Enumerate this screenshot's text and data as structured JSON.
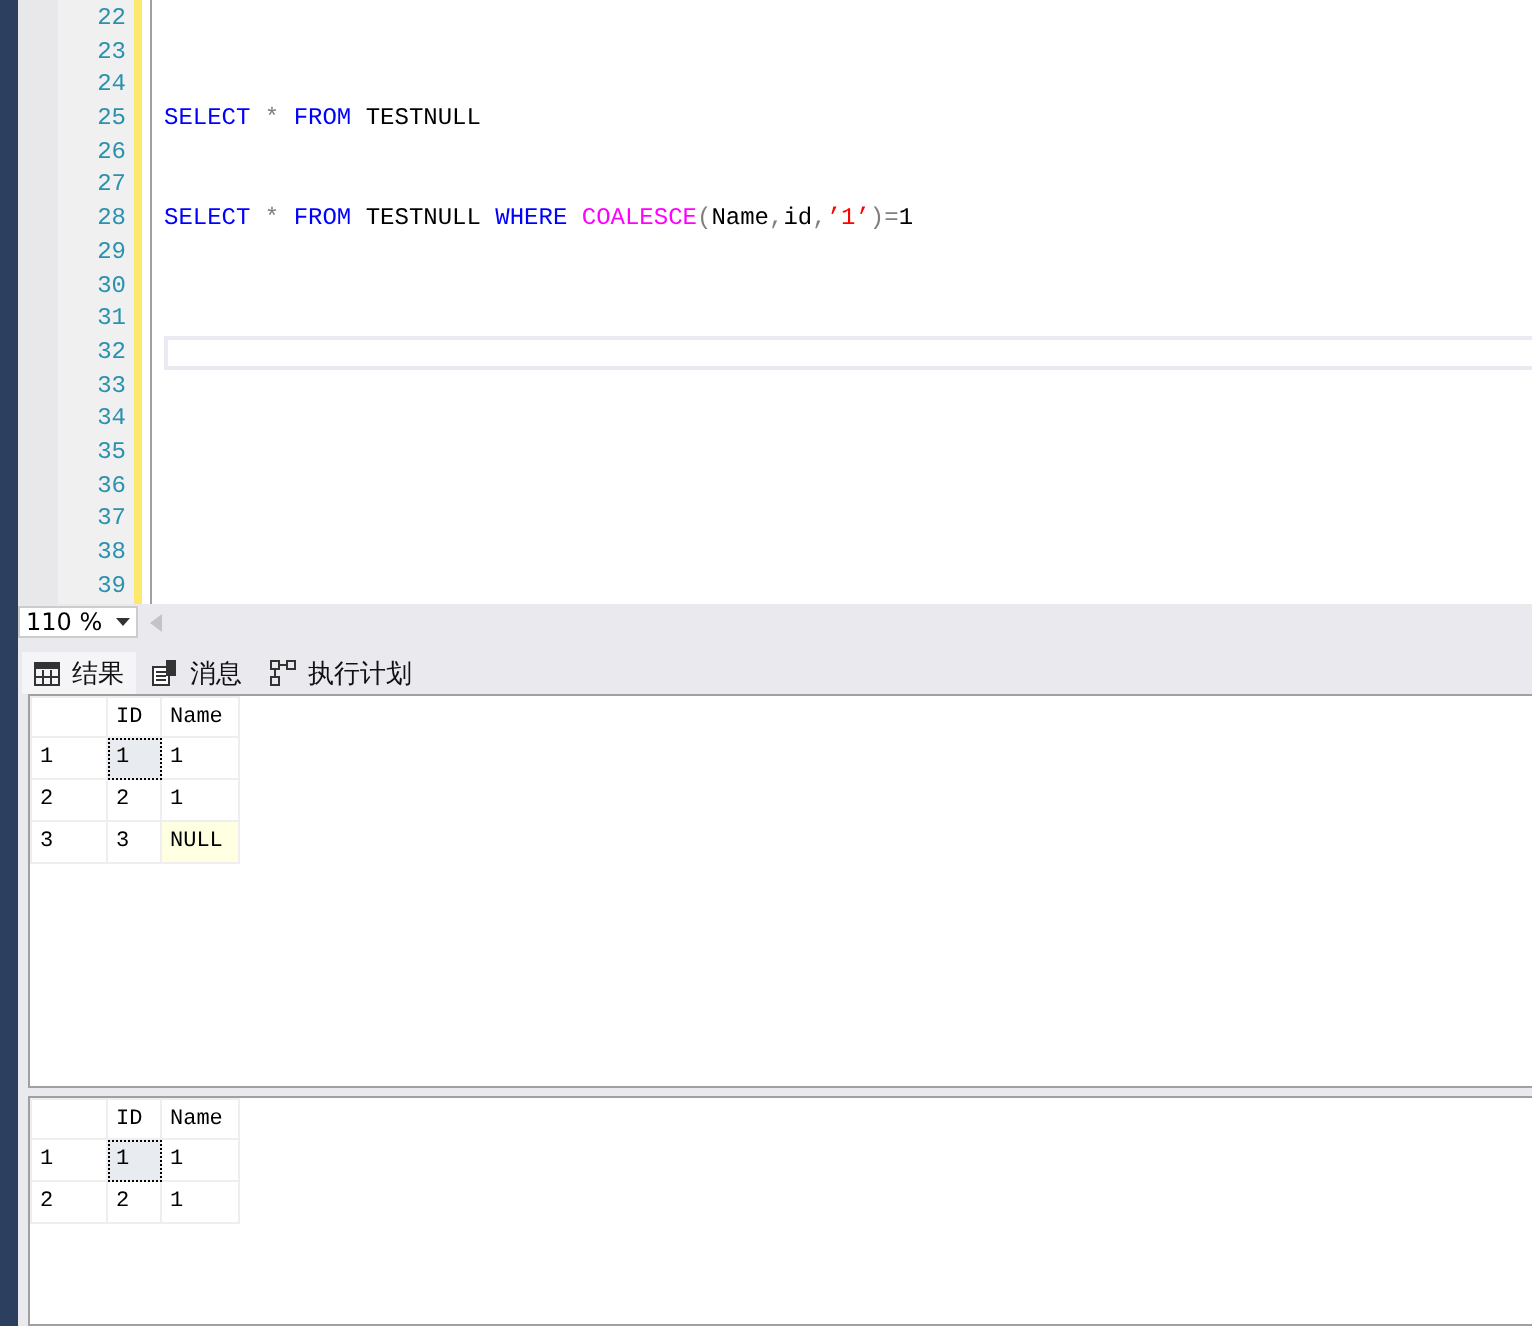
{
  "editor": {
    "lines": [
      {
        "number": "22"
      },
      {
        "number": "23"
      },
      {
        "number": "24"
      },
      {
        "number": "25",
        "tokens": [
          {
            "kind": "keyword",
            "text": "SELECT"
          },
          {
            "kind": "operator",
            "text": " * "
          },
          {
            "kind": "keyword",
            "text": "FROM"
          },
          {
            "kind": "identifier",
            "text": " TESTNULL"
          }
        ]
      },
      {
        "number": "26"
      },
      {
        "number": "27"
      },
      {
        "number": "28",
        "tokens": [
          {
            "kind": "keyword",
            "text": "SELECT"
          },
          {
            "kind": "operator",
            "text": " * "
          },
          {
            "kind": "keyword",
            "text": "FROM"
          },
          {
            "kind": "identifier",
            "text": " TESTNULL "
          },
          {
            "kind": "keyword",
            "text": "WHERE"
          },
          {
            "kind": "function",
            "text": " COALESCE"
          },
          {
            "kind": "punct",
            "text": "("
          },
          {
            "kind": "identifier",
            "text": "Name"
          },
          {
            "kind": "punct",
            "text": ","
          },
          {
            "kind": "identifier",
            "text": "id"
          },
          {
            "kind": "punct",
            "text": ","
          },
          {
            "kind": "string",
            "text": "’1’"
          },
          {
            "kind": "punct",
            "text": ")="
          },
          {
            "kind": "identifier",
            "text": "1"
          }
        ]
      },
      {
        "number": "29"
      },
      {
        "number": "30"
      },
      {
        "number": "31"
      },
      {
        "number": "32",
        "current": true
      },
      {
        "number": "33"
      },
      {
        "number": "34"
      },
      {
        "number": "35"
      },
      {
        "number": "36"
      },
      {
        "number": "37"
      },
      {
        "number": "38"
      },
      {
        "number": "39"
      }
    ]
  },
  "zoom": {
    "value": "110 %"
  },
  "tabs": [
    {
      "label": "结果",
      "kind": "grid",
      "selected": true
    },
    {
      "label": "消息",
      "kind": "message",
      "selected": false
    },
    {
      "label": "执行计划",
      "kind": "plan",
      "selected": false
    }
  ],
  "result_grids": [
    {
      "columns": [
        "ID",
        "Name"
      ],
      "rows": [
        {
          "number": "1",
          "cells": [
            {
              "text": "1",
              "focused": true,
              "null": false
            },
            {
              "text": "1",
              "focused": false,
              "null": false
            }
          ]
        },
        {
          "number": "2",
          "cells": [
            {
              "text": "2",
              "focused": false,
              "null": false
            },
            {
              "text": "1",
              "focused": false,
              "null": false
            }
          ]
        },
        {
          "number": "3",
          "cells": [
            {
              "text": "3",
              "focused": false,
              "null": false
            },
            {
              "text": "NULL",
              "focused": false,
              "null": true
            }
          ]
        }
      ]
    },
    {
      "columns": [
        "ID",
        "Name"
      ],
      "rows": [
        {
          "number": "1",
          "cells": [
            {
              "text": "1",
              "focused": true,
              "null": false
            },
            {
              "text": "1",
              "focused": false,
              "null": false
            }
          ]
        },
        {
          "number": "2",
          "cells": [
            {
              "text": "2",
              "focused": false,
              "null": false
            },
            {
              "text": "1",
              "focused": false,
              "null": false
            }
          ]
        }
      ]
    }
  ]
}
